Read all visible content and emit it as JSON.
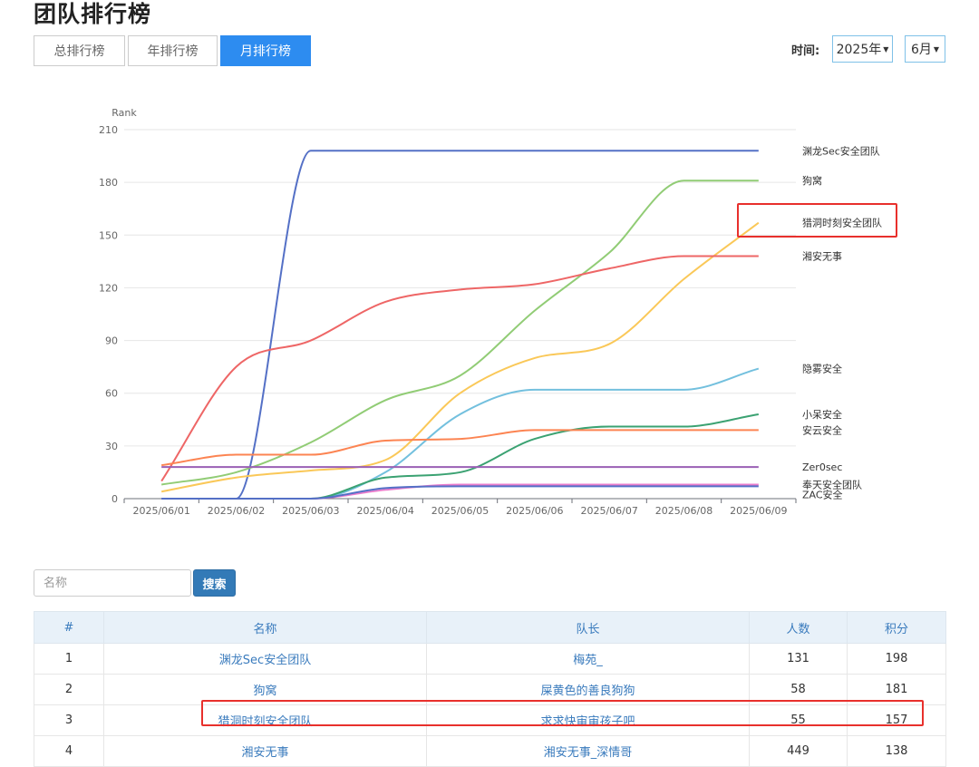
{
  "page": {
    "title": "团队排行榜"
  },
  "tabs": [
    {
      "label": "总排行榜",
      "active": false
    },
    {
      "label": "年排行榜",
      "active": false
    },
    {
      "label": "月排行榜",
      "active": true
    }
  ],
  "filters": {
    "label": "时间:",
    "year": "2025年",
    "month": "6月"
  },
  "chart_data": {
    "type": "line",
    "ylabel": "Rank",
    "ylim": [
      0,
      210
    ],
    "yticks": [
      0,
      30,
      60,
      90,
      120,
      150,
      180,
      210
    ],
    "categories": [
      "2025/06/01",
      "2025/06/02",
      "2025/06/03",
      "2025/06/04",
      "2025/06/05",
      "2025/06/06",
      "2025/06/07",
      "2025/06/08",
      "2025/06/09"
    ],
    "grid": true,
    "legend": "end-labels",
    "series": [
      {
        "name": "渊龙Sec安全团队",
        "color": "#5470c6",
        "values": [
          0,
          0,
          198,
          198,
          198,
          198,
          198,
          198,
          198
        ]
      },
      {
        "name": "狗窝",
        "color": "#91cc75",
        "values": [
          8,
          15,
          32,
          56,
          70,
          107,
          140,
          181,
          181
        ]
      },
      {
        "name": "猎洞时刻安全团队",
        "color": "#fac858",
        "values": [
          4,
          12,
          16,
          22,
          60,
          80,
          88,
          125,
          157
        ]
      },
      {
        "name": "湘安无事",
        "color": "#ee6666",
        "values": [
          10,
          75,
          90,
          112,
          119,
          122,
          131,
          138,
          138
        ]
      },
      {
        "name": "隐雾安全",
        "color": "#73c0de",
        "values": [
          0,
          0,
          0,
          15,
          48,
          62,
          62,
          62,
          74
        ]
      },
      {
        "name": "小呆安全",
        "color": "#3ba272",
        "values": [
          0,
          0,
          0,
          12,
          15,
          34,
          41,
          41,
          48
        ]
      },
      {
        "name": "安云安全",
        "color": "#fc8452",
        "values": [
          19,
          25,
          25,
          33,
          34,
          39,
          39,
          39,
          39
        ]
      },
      {
        "name": "Zer0sec",
        "color": "#9a60b4",
        "values": [
          18,
          18,
          18,
          18,
          18,
          18,
          18,
          18,
          18
        ]
      },
      {
        "name": "奉天安全团队",
        "color": "#ea7ccc",
        "values": [
          0,
          0,
          0,
          5,
          8,
          8,
          8,
          8,
          8
        ]
      },
      {
        "name": "ZAC安全",
        "color": "#5470c6",
        "values": [
          0,
          0,
          0,
          6,
          7,
          7,
          7,
          7,
          7
        ]
      }
    ]
  },
  "search": {
    "placeholder": "名称",
    "button_label": "搜索"
  },
  "table": {
    "headers": [
      "#",
      "名称",
      "队长",
      "人数",
      "积分"
    ],
    "rows": [
      {
        "rank": "1",
        "name": "渊龙Sec安全团队",
        "captain": "梅苑_",
        "members": "131",
        "score": "198"
      },
      {
        "rank": "2",
        "name": "狗窝",
        "captain": "屎黄色的善良狗狗",
        "members": "58",
        "score": "181"
      },
      {
        "rank": "3",
        "name": "猎洞时刻安全团队",
        "captain": "求求快审审孩子吧",
        "members": "55",
        "score": "157"
      },
      {
        "rank": "4",
        "name": "湘安无事",
        "captain": "湘安无事_深情哥",
        "members": "449",
        "score": "138"
      }
    ]
  }
}
